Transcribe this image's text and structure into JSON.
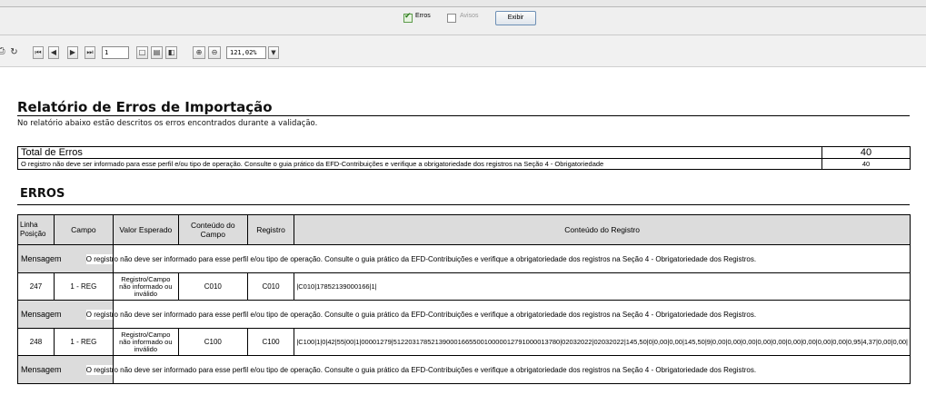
{
  "filters": {
    "erros": {
      "label": "Erros",
      "checked": true
    },
    "avisos": {
      "label": "Avisos",
      "checked": false
    },
    "exibir_label": "Exibir"
  },
  "toolbar": {
    "page_value": "1",
    "zoom_value": "121,02%"
  },
  "report": {
    "title": "Relatório de Erros de Importação",
    "subtitle": "No relatório abaixo estão descritos os erros encontrados durante a validação.",
    "total": {
      "header_label": "Total de Erros",
      "header_value": "40",
      "rows": [
        {
          "text": "O registro não deve ser informado para esse perfil e/ou tipo de operação. Consulte o guia prático da EFD-Contribuições e verifique a obrigatoriedade dos registros na Seção 4 - Obrigatoriedade",
          "value": "40"
        }
      ]
    },
    "errors_title": "ERROS",
    "columns": {
      "linha_posicao": [
        "Linha",
        "Posição"
      ],
      "campo": "Campo",
      "valor_esperado": "Valor Esperado",
      "conteudo_campo": "Conteúdo do Campo",
      "registro": "Registro",
      "conteudo_registro": "Conteúdo do Registro"
    },
    "message_label": "Mensagem",
    "message_text": "O registro não deve ser informado para esse perfil e/ou tipo de operação. Consulte o guia prático da EFD-Contribuições e verifique a obrigatoriedade dos registros na Seção 4 - Obrigatoriedade dos Registros.",
    "rows": [
      {
        "linha": "247",
        "campo": "1 - REG",
        "valor_esperado": "Registro/Campo não informado ou inválido",
        "conteudo_campo": "C010",
        "registro": "C010",
        "conteudo_registro": "|C010|17852139000166|1|"
      },
      {
        "linha": "248",
        "campo": "1 - REG",
        "valor_esperado": "Registro/Campo não informado ou inválido",
        "conteudo_campo": "C100",
        "registro": "C100",
        "conteudo_registro": "|C100|1|0|42|55|00|1|00001279|51220317852139000166550010000012791000013780|02032022|02032022|145,50|0|0,00|0,00|145,50|9|0,00|0,00|0,00|0,00|0,00|0,00|0,00|0,00|0,00|0,95|4,37|0,00|0,00|"
      }
    ]
  }
}
